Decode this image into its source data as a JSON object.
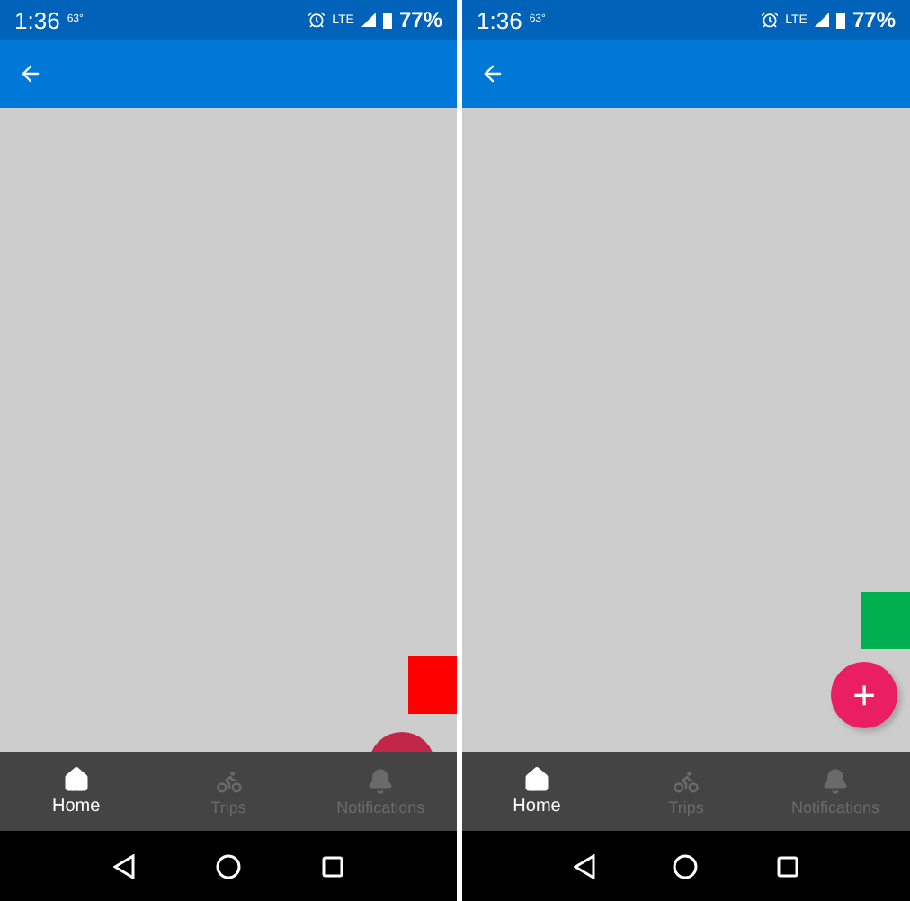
{
  "screens": [
    {
      "status": {
        "time": "1:36",
        "temperature": "63°",
        "network": "LTE",
        "battery": "77%"
      },
      "square": {
        "color": "#ff0000"
      },
      "fab": {
        "covered": true
      },
      "tabs": [
        {
          "label": "Home",
          "selected": true
        },
        {
          "label": "Trips",
          "selected": false
        },
        {
          "label": "Notifications",
          "selected": false
        }
      ]
    },
    {
      "status": {
        "time": "1:36",
        "temperature": "63°",
        "network": "LTE",
        "battery": "77%"
      },
      "square": {
        "color": "#00b050"
      },
      "fab": {
        "covered": false,
        "label": "+"
      },
      "tabs": [
        {
          "label": "Home",
          "selected": true
        },
        {
          "label": "Trips",
          "selected": false
        },
        {
          "label": "Notifications",
          "selected": false
        }
      ]
    }
  ]
}
